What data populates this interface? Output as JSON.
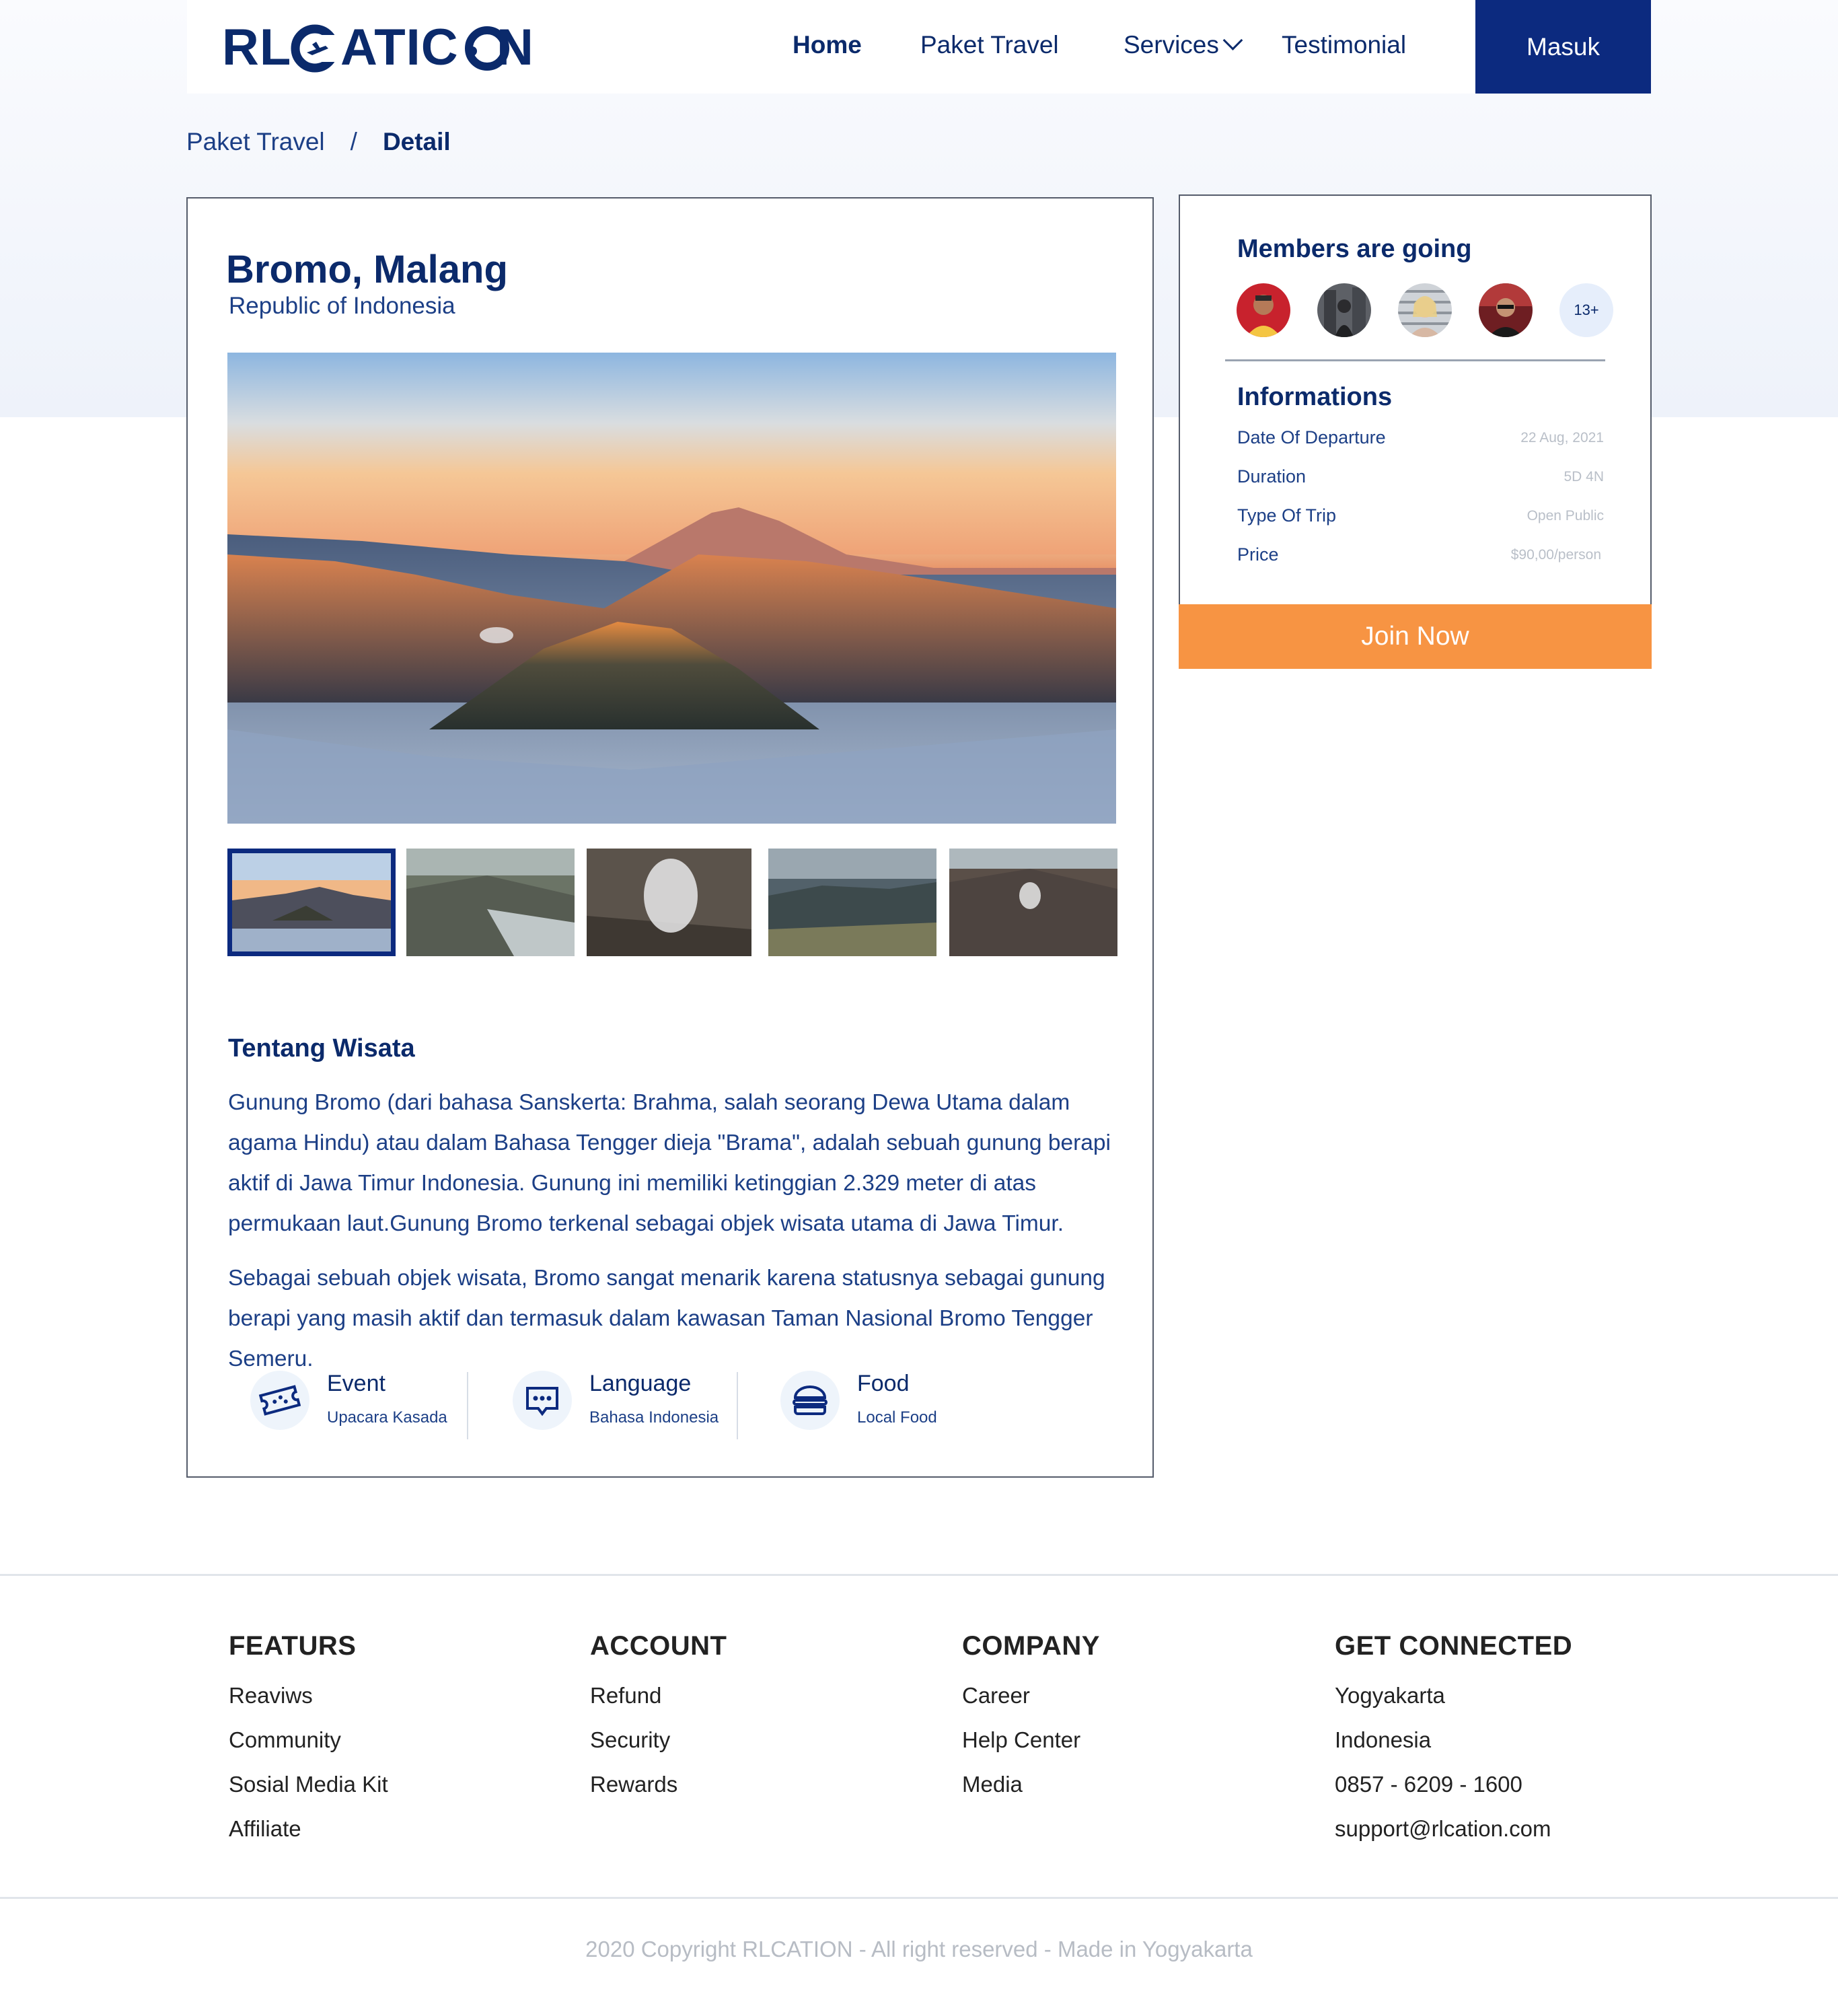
{
  "brand": {
    "name": "RLCATION"
  },
  "nav": {
    "items": [
      {
        "label": "Home",
        "active": true
      },
      {
        "label": "Paket Travel"
      },
      {
        "label": "Services"
      },
      {
        "label": "Testimonial"
      }
    ],
    "login_label": "Masuk"
  },
  "breadcrumb": {
    "parent": "Paket Travel",
    "separator": "/",
    "current": "Detail"
  },
  "destination": {
    "title": "Bromo, Malang",
    "subtitle": "Republic of Indonesia",
    "about_title": "Tentang Wisata",
    "about_paragraphs": [
      "Gunung Bromo (dari bahasa Sanskerta: Brahma, salah seorang Dewa Utama dalam agama Hindu) atau dalam Bahasa Tengger dieja \"Brama\", adalah sebuah gunung berapi aktif di Jawa Timur Indonesia. Gunung ini memiliki ketinggian 2.329 meter di atas permukaan laut.Gunung Bromo terkenal sebagai objek wisata utama di Jawa Timur.",
      "Sebagai sebuah objek wisata, Bromo sangat menarik karena statusnya sebagai gunung berapi yang masih aktif dan termasuk dalam kawasan Taman Nasional Bromo Tengger Semeru."
    ],
    "features": [
      {
        "title": "Event",
        "value": "Upacara Kasada",
        "icon": "ticket-icon"
      },
      {
        "title": "Language",
        "value": "Bahasa Indonesia",
        "icon": "chat-icon"
      },
      {
        "title": "Food",
        "value": "Local Food",
        "icon": "burger-icon"
      }
    ]
  },
  "sidebar": {
    "members_title": "Members are going",
    "members_more": "13+",
    "info_title": "Informations",
    "info": [
      {
        "label": "Date Of Departure",
        "value": "22 Aug, 2021"
      },
      {
        "label": "Duration",
        "value": "5D 4N"
      },
      {
        "label": "Type Of Trip",
        "value": "Open Public"
      },
      {
        "label": "Price",
        "value": "$90,00/person"
      }
    ],
    "cta": "Join Now"
  },
  "footer": {
    "columns": [
      {
        "heading": "FEATURS",
        "links": [
          "Reaviws",
          "Community",
          "Sosial Media Kit",
          "Affiliate"
        ]
      },
      {
        "heading": "ACCOUNT",
        "links": [
          "Refund",
          "Security",
          "Rewards"
        ]
      },
      {
        "heading": "COMPANY",
        "links": [
          "Career",
          "Help Center",
          "Media"
        ]
      },
      {
        "heading": "GET CONNECTED",
        "links": [
          "Yogyakarta",
          "Indonesia",
          "0857 - 6209 - 1600",
          "support@rlcation.com"
        ]
      }
    ],
    "copyright": "2020 Copyright RLCATION  - All right reserved - Made in Yogyakarta"
  },
  "colors": {
    "primary": "#0c2a7f",
    "accent": "#f79443",
    "text": "#1c3f86"
  }
}
